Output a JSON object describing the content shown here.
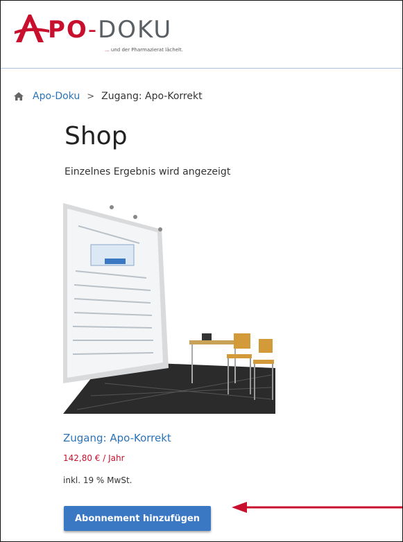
{
  "brand": {
    "logo_a": "A",
    "logo_po": "PO",
    "logo_dash": "-",
    "logo_doku": "DOKU",
    "tagline_dots": "...",
    "tagline": " und der Pharmazierat lächelt."
  },
  "breadcrumb": {
    "home_icon": "home-icon",
    "link": "Apo-Doku",
    "separator": ">",
    "current": "Zugang: Apo-Korrekt"
  },
  "page": {
    "title": "Shop",
    "result_count": "Einzelnes Ergebnis wird angezeigt"
  },
  "product": {
    "name": "Zugang: Apo-Korrekt",
    "price": "142,80 € / Jahr",
    "vat_note": "inkl. 19 % MwSt.",
    "button_label": "Abonnement hinzufügen"
  },
  "colors": {
    "brand_red": "#c8102e",
    "link_blue": "#2a73b8",
    "button_blue": "#3a78c4"
  }
}
